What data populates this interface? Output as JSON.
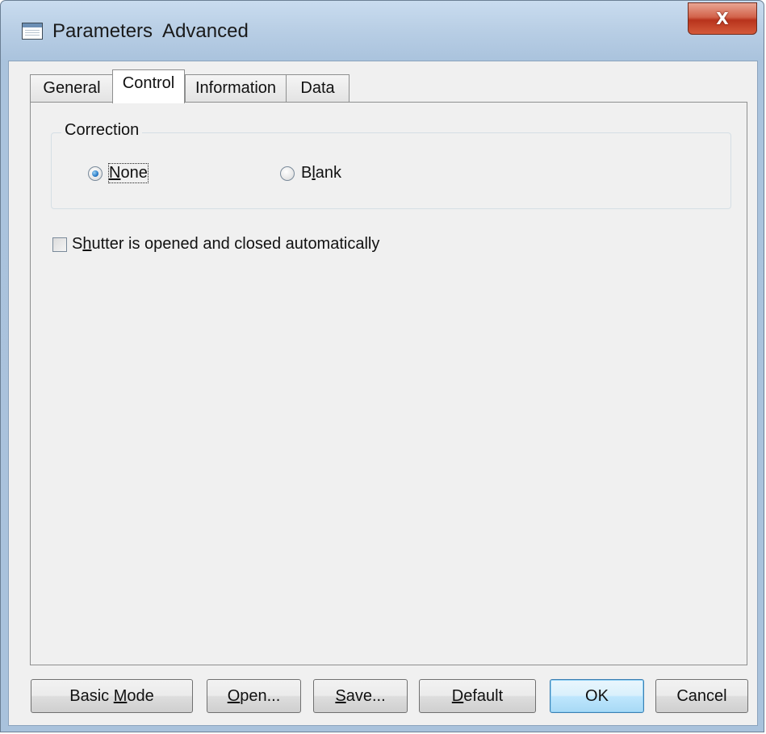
{
  "window": {
    "title": "Parameters  Advanced",
    "close_glyph": "X"
  },
  "tabs": [
    {
      "label": "General",
      "active": false
    },
    {
      "label": "Control",
      "active": true
    },
    {
      "label": "Information",
      "active": false
    },
    {
      "label": "Data",
      "active": false
    }
  ],
  "correction": {
    "legend": "Correction",
    "options": [
      {
        "label_pre": "",
        "label_mnemonic": "N",
        "label_post": "one",
        "checked": true
      },
      {
        "label_pre": "B",
        "label_mnemonic": "l",
        "label_post": "ank",
        "checked": false
      }
    ]
  },
  "shutter": {
    "label_pre": "S",
    "label_mnemonic": "h",
    "label_post": "utter is opened and closed automatically",
    "checked": false
  },
  "buttons": {
    "basic_mode": {
      "pre": "Basic ",
      "mnemonic": "M",
      "post": "ode"
    },
    "open": {
      "pre": "",
      "mnemonic": "O",
      "post": "pen..."
    },
    "save": {
      "pre": "",
      "mnemonic": "S",
      "post": "ave..."
    },
    "default": {
      "pre": "",
      "mnemonic": "D",
      "post": "efault"
    },
    "ok": {
      "label": "OK"
    },
    "cancel": {
      "label": "Cancel"
    }
  },
  "colors": {
    "window_frame": "#a9c2dc",
    "client_bg": "#f0f0f0",
    "close_button": "#c8452c",
    "default_button_border": "#3c7fb1"
  }
}
